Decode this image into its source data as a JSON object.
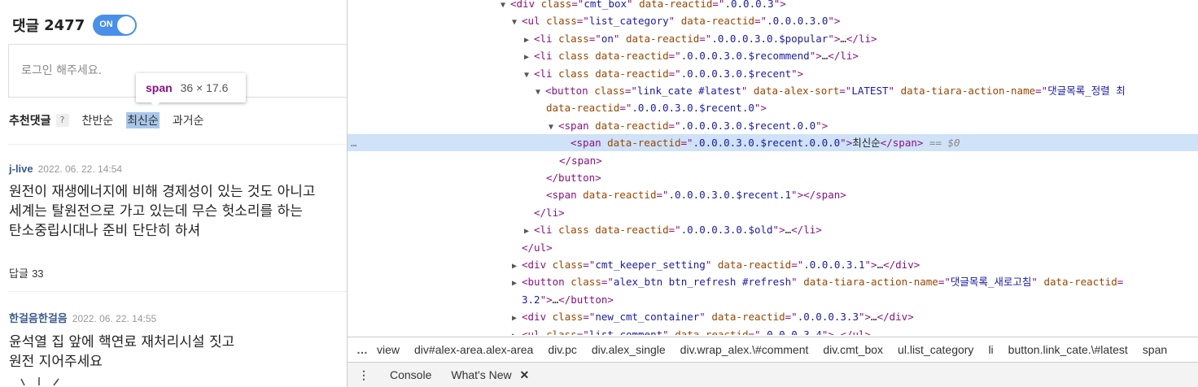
{
  "comments_panel": {
    "title": "댓글",
    "count": "2477",
    "toggle_label": "ON",
    "login_placeholder": "로그인 해주세요.",
    "tooltip": {
      "tag": "span",
      "size": "36 × 17.6"
    },
    "sort_tabs": [
      {
        "label": "추천댓글"
      },
      {
        "label": "?"
      },
      {
        "label": "찬반순"
      },
      {
        "label": "최신순"
      },
      {
        "label": "과거순"
      }
    ],
    "comments": [
      {
        "user": "j-live",
        "date": "2022. 06. 22. 14:54",
        "lines": [
          "원전이 재생에너지에 비해 경제성이 있는 것도 아니고",
          "세계는 탈원전으로 가고 있는데 무슨 헛소리를 하는",
          "탄소중립시대나 준비 단단히 하셔"
        ],
        "reply_label": "답글",
        "reply_count": "33"
      },
      {
        "user": "한걸음한걸음",
        "date": "2022. 06. 22. 14:55",
        "lines": [
          "윤석열 집 앞에 핵연료 재처리시설 짓고",
          "원전 지어주세요"
        ]
      }
    ]
  },
  "devtools": {
    "dom_lines": [
      {
        "indent": 614,
        "tw": "▼",
        "parts": [
          [
            "tg",
            "<div "
          ],
          [
            "an",
            "class"
          ],
          [
            "tg",
            "=\""
          ],
          [
            "av",
            "cmt_box"
          ],
          [
            "tg",
            "\" "
          ],
          [
            "an",
            "data-reactid"
          ],
          [
            "tg",
            "=\""
          ],
          [
            "av",
            ".0.0.0.3"
          ],
          [
            "tg",
            "\">"
          ]
        ]
      },
      {
        "indent": 628,
        "tw": "▼",
        "parts": [
          [
            "tg",
            "<ul "
          ],
          [
            "an",
            "class"
          ],
          [
            "tg",
            "=\""
          ],
          [
            "av",
            "list_category"
          ],
          [
            "tg",
            "\" "
          ],
          [
            "an",
            "data-reactid"
          ],
          [
            "tg",
            "=\""
          ],
          [
            "av",
            ".0.0.0.3.0"
          ],
          [
            "tg",
            "\">"
          ]
        ]
      },
      {
        "indent": 643,
        "tw": "▶",
        "parts": [
          [
            "tg",
            "<li "
          ],
          [
            "an",
            "class"
          ],
          [
            "tg",
            "=\""
          ],
          [
            "av",
            "on"
          ],
          [
            "tg",
            "\" "
          ],
          [
            "an",
            "data-reactid"
          ],
          [
            "tg",
            "=\""
          ],
          [
            "av",
            ".0.0.0.3.0.$popular"
          ],
          [
            "tg",
            "\">"
          ],
          [
            "tx",
            "…"
          ],
          [
            "tg",
            "</li>"
          ]
        ]
      },
      {
        "indent": 643,
        "tw": "▶",
        "parts": [
          [
            "tg",
            "<li "
          ],
          [
            "an",
            "class"
          ],
          [
            "tg",
            " "
          ],
          [
            "an",
            "data-reactid"
          ],
          [
            "tg",
            "=\""
          ],
          [
            "av",
            ".0.0.0.3.0.$recommend"
          ],
          [
            "tg",
            "\">"
          ],
          [
            "tx",
            "…"
          ],
          [
            "tg",
            "</li>"
          ]
        ]
      },
      {
        "indent": 643,
        "tw": "▼",
        "parts": [
          [
            "tg",
            "<li "
          ],
          [
            "an",
            "class"
          ],
          [
            "tg",
            " "
          ],
          [
            "an",
            "data-reactid"
          ],
          [
            "tg",
            "=\""
          ],
          [
            "av",
            ".0.0.0.3.0.$recent"
          ],
          [
            "tg",
            "\">"
          ]
        ]
      },
      {
        "indent": 657,
        "tw": "▼",
        "parts": [
          [
            "tg",
            "<button "
          ],
          [
            "an",
            "class"
          ],
          [
            "tg",
            "=\""
          ],
          [
            "av",
            "link_cate #latest"
          ],
          [
            "tg",
            "\" "
          ],
          [
            "an",
            "data-alex-sort"
          ],
          [
            "tg",
            "=\""
          ],
          [
            "av",
            "LATEST"
          ],
          [
            "tg",
            "\" "
          ],
          [
            "an",
            "data-tiara-action-name"
          ],
          [
            "tg",
            "=\""
          ],
          [
            "av",
            "댓글목록_정렬 최"
          ]
        ]
      },
      {
        "indent": 670,
        "tw": "",
        "parts": [
          [
            "an",
            "data-reactid"
          ],
          [
            "tg",
            "=\""
          ],
          [
            "av",
            ".0.0.0.3.0.$recent.0"
          ],
          [
            "tg",
            "\">"
          ]
        ]
      },
      {
        "indent": 673,
        "tw": "▼",
        "parts": [
          [
            "tg",
            "<span "
          ],
          [
            "an",
            "data-reactid"
          ],
          [
            "tg",
            "=\""
          ],
          [
            "av",
            ".0.0.0.3.0.$recent.0.0"
          ],
          [
            "tg",
            "\">"
          ]
        ]
      },
      {
        "indent": 700,
        "tw": "",
        "sel": true,
        "eq": " == $0",
        "parts": [
          [
            "tg",
            "<span "
          ],
          [
            "an",
            "data-reactid"
          ],
          [
            "tg",
            "=\""
          ],
          [
            "av",
            ".0.0.0.3.0.$recent.0.0.0"
          ],
          [
            "tg",
            "\">"
          ],
          [
            "tx",
            "최신순"
          ],
          [
            "tg",
            "</span>"
          ]
        ]
      },
      {
        "indent": 686,
        "tw": "",
        "parts": [
          [
            "tg",
            "</span>"
          ]
        ]
      },
      {
        "indent": 670,
        "tw": "",
        "parts": [
          [
            "tg",
            "</button>"
          ]
        ]
      },
      {
        "indent": 670,
        "tw": "",
        "parts": [
          [
            "tg",
            "<span "
          ],
          [
            "an",
            "data-reactid"
          ],
          [
            "tg",
            "=\""
          ],
          [
            "av",
            ".0.0.0.3.0.$recent.1"
          ],
          [
            "tg",
            "\"></span>"
          ]
        ]
      },
      {
        "indent": 655,
        "tw": "",
        "parts": [
          [
            "tg",
            "</li>"
          ]
        ]
      },
      {
        "indent": 643,
        "tw": "▶",
        "parts": [
          [
            "tg",
            "<li "
          ],
          [
            "an",
            "class"
          ],
          [
            "tg",
            " "
          ],
          [
            "an",
            "data-reactid"
          ],
          [
            "tg",
            "=\""
          ],
          [
            "av",
            ".0.0.0.3.0.$old"
          ],
          [
            "tg",
            "\">"
          ],
          [
            "tx",
            "…"
          ],
          [
            "tg",
            "</li>"
          ]
        ]
      },
      {
        "indent": 640,
        "tw": "",
        "parts": [
          [
            "tg",
            "</ul>"
          ]
        ]
      },
      {
        "indent": 628,
        "tw": "▶",
        "parts": [
          [
            "tg",
            "<div "
          ],
          [
            "an",
            "class"
          ],
          [
            "tg",
            "=\""
          ],
          [
            "av",
            "cmt_keeper_setting"
          ],
          [
            "tg",
            "\" "
          ],
          [
            "an",
            "data-reactid"
          ],
          [
            "tg",
            "=\""
          ],
          [
            "av",
            ".0.0.0.3.1"
          ],
          [
            "tg",
            "\">"
          ],
          [
            "tx",
            "…"
          ],
          [
            "tg",
            "</div>"
          ]
        ]
      },
      {
        "indent": 628,
        "tw": "▶",
        "parts": [
          [
            "tg",
            "<button "
          ],
          [
            "an",
            "class"
          ],
          [
            "tg",
            "=\""
          ],
          [
            "av",
            "alex_btn btn_refresh #refresh"
          ],
          [
            "tg",
            "\" "
          ],
          [
            "an",
            "data-tiara-action-name"
          ],
          [
            "tg",
            "=\""
          ],
          [
            "av",
            "댓글목록_새로고침"
          ],
          [
            "tg",
            "\" "
          ],
          [
            "an",
            "data-reactid"
          ],
          [
            "tg",
            "="
          ]
        ]
      },
      {
        "indent": 640,
        "tw": "",
        "parts": [
          [
            "av",
            "3.2"
          ],
          [
            "tg",
            "\">"
          ],
          [
            "tx",
            "…"
          ],
          [
            "tg",
            "</button>"
          ]
        ]
      },
      {
        "indent": 628,
        "tw": "▶",
        "parts": [
          [
            "tg",
            "<div "
          ],
          [
            "an",
            "class"
          ],
          [
            "tg",
            "=\""
          ],
          [
            "av",
            "new_cmt_container"
          ],
          [
            "tg",
            "\" "
          ],
          [
            "an",
            "data-reactid"
          ],
          [
            "tg",
            "=\""
          ],
          [
            "av",
            ".0.0.0.3.3"
          ],
          [
            "tg",
            "\">"
          ],
          [
            "tx",
            "…"
          ],
          [
            "tg",
            "</div>"
          ]
        ]
      },
      {
        "indent": 628,
        "tw": "▶",
        "parts": [
          [
            "tg",
            "<ul "
          ],
          [
            "an",
            "class"
          ],
          [
            "tg",
            "=\""
          ],
          [
            "av",
            "list_comment"
          ],
          [
            "tg",
            "\" "
          ],
          [
            "an",
            "data-reactid"
          ],
          [
            "tg",
            "=\""
          ],
          [
            "av",
            ".0.0.0.3.4"
          ],
          [
            "tg",
            "\">"
          ],
          [
            "tx",
            "…"
          ],
          [
            "tg",
            "</ul>"
          ]
        ]
      }
    ],
    "breadcrumbs": [
      "view",
      "div#alex-area.alex-area",
      "div.pc",
      "div.alex_single",
      "div.wrap_alex.\\#comment",
      "div.cmt_box",
      "ul.list_category",
      "li",
      "button.link_cate.\\#latest",
      "span"
    ],
    "drawer_tabs": [
      "Console",
      "What's New"
    ],
    "close_glyph": "✕",
    "more_glyph": "…",
    "menu_glyph": "⋮",
    "row_dots": "…"
  }
}
